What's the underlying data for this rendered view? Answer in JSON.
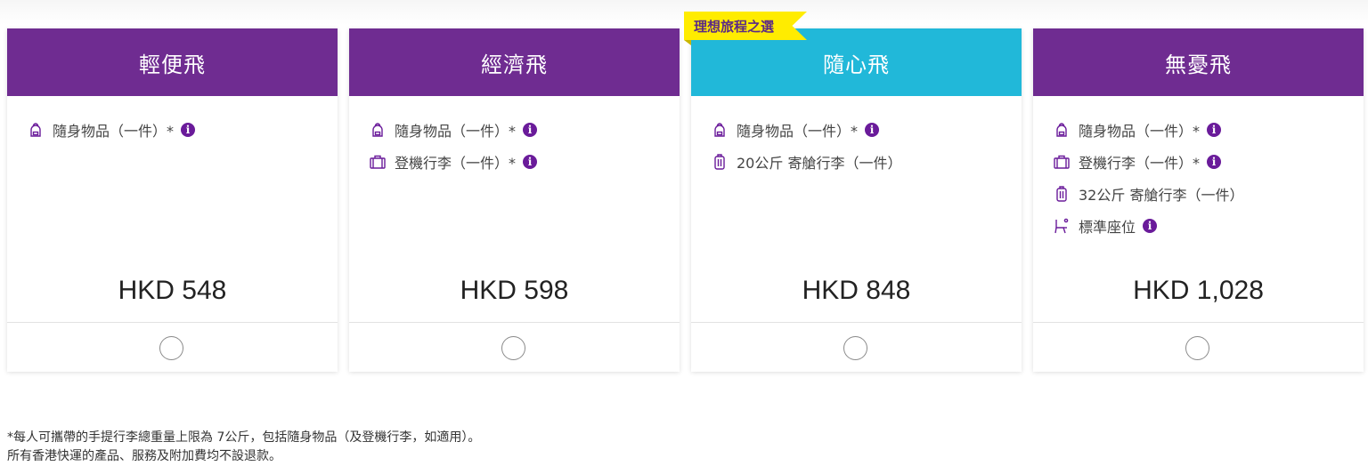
{
  "colors": {
    "purple": "#6f2c91",
    "cyan": "#21b8d9",
    "icon": "#6a1b9a",
    "ribbon": "#ffec00"
  },
  "ribbon": {
    "label": "理想旅程之選"
  },
  "plans": [
    {
      "name": "輕便飛",
      "header_color": "#6f2c91",
      "features": [
        {
          "icon": "backpack-icon",
          "text": "隨身物品（一件）*",
          "info": true
        }
      ],
      "price": "HKD 548",
      "selected": false
    },
    {
      "name": "經濟飛",
      "header_color": "#6f2c91",
      "features": [
        {
          "icon": "backpack-icon",
          "text": "隨身物品（一件）*",
          "info": true
        },
        {
          "icon": "carry-on-bag-icon",
          "text": "登機行李（一件）*",
          "info": true
        }
      ],
      "price": "HKD 598",
      "selected": false
    },
    {
      "name": "隨心飛",
      "header_color": "#21b8d9",
      "features": [
        {
          "icon": "backpack-icon",
          "text": "隨身物品（一件）*",
          "info": true
        },
        {
          "icon": "checked-suitcase-icon",
          "text": "20公斤 寄艙行李（一件）",
          "info": false
        }
      ],
      "price": "HKD 848",
      "selected": false
    },
    {
      "name": "無憂飛",
      "header_color": "#6f2c91",
      "features": [
        {
          "icon": "backpack-icon",
          "text": "隨身物品（一件）*",
          "info": true
        },
        {
          "icon": "carry-on-bag-icon",
          "text": "登機行李（一件）*",
          "info": true
        },
        {
          "icon": "checked-suitcase-icon",
          "text": "32公斤 寄艙行李（一件）",
          "info": false
        },
        {
          "icon": "seat-icon",
          "text": "標準座位",
          "info": true
        }
      ],
      "price": "HKD 1,028",
      "selected": false
    }
  ],
  "footnotes": {
    "line1": "*每人可攜帶的手提行李總重量上限為 7公斤，包括隨身物品（及登機行李，如適用）。",
    "line2": "所有香港快運的產品、服務及附加費均不設退款。"
  }
}
